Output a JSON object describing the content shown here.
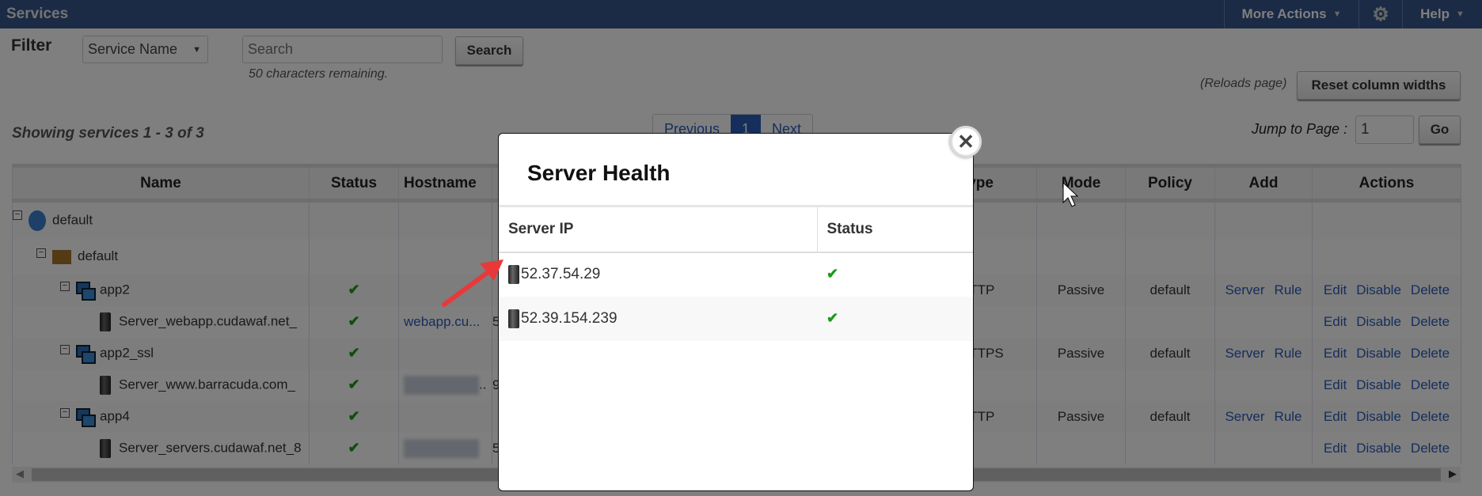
{
  "header": {
    "title": "Services",
    "more_actions": "More Actions",
    "settings_icon": "gear-icon",
    "help": "Help"
  },
  "filter": {
    "label": "Filter",
    "field_select": "Service Name",
    "search_placeholder": "Search",
    "search_button": "Search",
    "chars_remaining": "50 characters remaining."
  },
  "reload_note": "(Reloads page)",
  "reset_button": "Reset column widths",
  "showing": "Showing services 1 - 3 of 3",
  "pagination": {
    "previous": "Previous",
    "current": "1",
    "next": "Next",
    "jump_label": "Jump to Page :",
    "jump_value": "1",
    "go": "Go"
  },
  "columns": [
    "Name",
    "Status",
    "Hostname",
    "Type",
    "Mode",
    "Policy",
    "Add",
    "Actions"
  ],
  "rows": [
    {
      "name": "default",
      "status": "",
      "hostname": "",
      "partial": "",
      "type": "",
      "mode": "",
      "policy": "",
      "add": [],
      "actions": []
    },
    {
      "name": "default",
      "status": "",
      "hostname": "",
      "partial": "",
      "type": "",
      "mode": "",
      "policy": "",
      "add": [],
      "actions": []
    },
    {
      "name": "app2",
      "status": "✔",
      "hostname": "",
      "partial": "",
      "type": "HTTP",
      "mode": "Passive",
      "policy": "default",
      "add": [
        "Server",
        "Rule"
      ],
      "actions": [
        "Edit",
        "Disable",
        "Delete"
      ]
    },
    {
      "name": "Server_webapp.cudawaf.net_",
      "status": "✔",
      "hostname": "webapp.cu...",
      "partial": "5",
      "type": "",
      "mode": "",
      "policy": "",
      "add": [],
      "actions": [
        "Edit",
        "Disable",
        "Delete"
      ]
    },
    {
      "name": "app2_ssl",
      "status": "✔",
      "hostname": "",
      "partial": "",
      "type": "HTTPS",
      "mode": "Passive",
      "policy": "default",
      "add": [
        "Server",
        "Rule"
      ],
      "actions": [
        "Edit",
        "Disable",
        "Delete"
      ]
    },
    {
      "name": "Server_www.barracuda.com_",
      "status": "✔",
      "hostname": "..",
      "partial": "9",
      "type": "",
      "mode": "",
      "policy": "",
      "add": [],
      "actions": [
        "Edit",
        "Disable",
        "Delete"
      ]
    },
    {
      "name": "app4",
      "status": "✔",
      "hostname": "",
      "partial": "",
      "type": "HTTP",
      "mode": "Passive",
      "policy": "default",
      "add": [
        "Server",
        "Rule"
      ],
      "actions": [
        "Edit",
        "Disable",
        "Delete"
      ]
    },
    {
      "name": "Server_servers.cudawaf.net_8",
      "status": "✔",
      "hostname": "",
      "partial": "5",
      "type": "",
      "mode": "",
      "policy": "",
      "add": [],
      "actions": [
        "Edit",
        "Disable",
        "Delete"
      ]
    }
  ],
  "modal": {
    "title": "Server Health",
    "columns": [
      "Server IP",
      "Status"
    ],
    "rows": [
      {
        "ip": "52.37.54.29",
        "status": "✔"
      },
      {
        "ip": "52.39.154.239",
        "status": "✔"
      }
    ],
    "close_icon": "close-icon"
  },
  "colors": {
    "header": "#36548a",
    "link": "#2a5db8",
    "ok": "#1a9c1a",
    "arrow": "#e8393a"
  }
}
